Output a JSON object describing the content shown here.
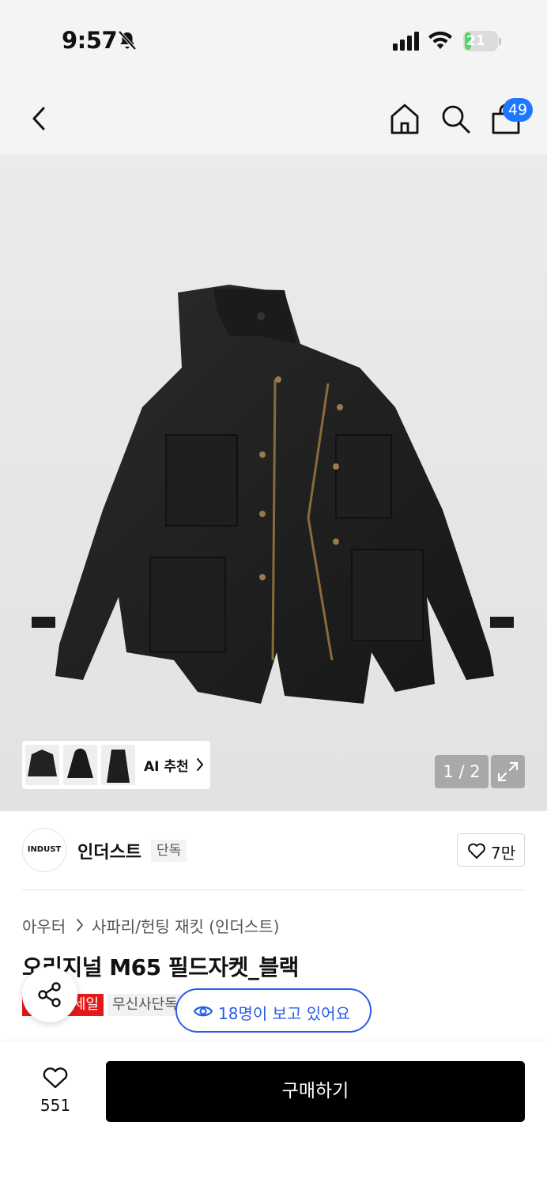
{
  "status_bar": {
    "time": "9:57",
    "battery_percent": "21",
    "battery_level": 0.21
  },
  "nav": {
    "cart_badge": "49"
  },
  "gallery": {
    "ai_label": "AI 추천",
    "counter": "1 / 2"
  },
  "brand": {
    "logo_text": "INDUST",
    "name": "인더스트",
    "tag": "단독",
    "likes": "7만"
  },
  "breadcrumb": {
    "category": "아우터",
    "subcategory": "사파리/헌팅 재킷 (인더스트)"
  },
  "product": {
    "title": "오리지널 M65 필드자켓_블랙"
  },
  "tags": {
    "sale": "세일",
    "exclusive": "무신사단독"
  },
  "viewers_text": "18명이 보고 있어요",
  "bottom": {
    "wish_count": "551",
    "buy_label": "구매하기"
  },
  "colors": {
    "accent_blue": "#2a5ee8",
    "badge_blue": "#1c78ff",
    "sale_red": "#e51717",
    "battery_green": "#4cd964"
  }
}
